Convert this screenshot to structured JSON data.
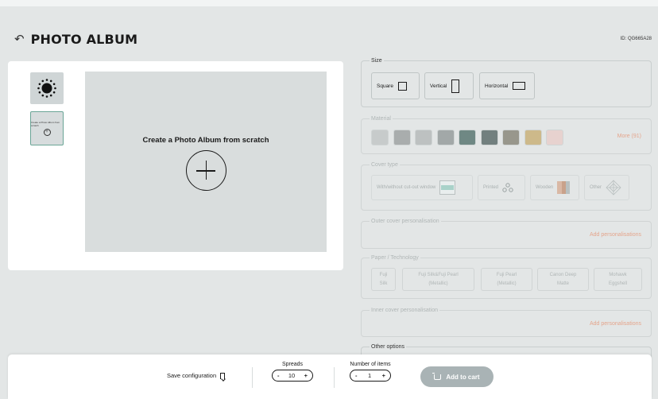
{
  "header": {
    "title": "PHOTO ALBUM",
    "back_icon": "back-arrow-icon",
    "product_id": "ID: QG665A28"
  },
  "preview": {
    "canvas_title": "Create a Photo Album from scratch",
    "thumb_mini_text": "Create a Photo Album from scratch"
  },
  "size": {
    "legend": "Size",
    "options": [
      {
        "label": "Square",
        "icon": "square-shape-icon"
      },
      {
        "label": "Vertical",
        "icon": "vertical-shape-icon"
      },
      {
        "label": "Horizontal",
        "icon": "horizontal-shape-icon"
      }
    ]
  },
  "material": {
    "legend": "Material",
    "swatches": [
      "#c7cbcb",
      "#a9adad",
      "#bdc1c1",
      "#a2a8a8",
      "#6f8884",
      "#72807f",
      "#98978c",
      "#cdb98a",
      "#e7d2cf"
    ],
    "more": "More (91)"
  },
  "cover_type": {
    "legend": "Cover type",
    "options": [
      {
        "label": "With/without cut-out window"
      },
      {
        "label": "Printed"
      },
      {
        "label": "Wooden"
      },
      {
        "label": "Other"
      }
    ]
  },
  "outer_cover": {
    "legend": "Outer cover personalisation",
    "link": "Add personalisations"
  },
  "paper": {
    "legend": "Paper / Technology",
    "options": [
      {
        "line1": "Fuji",
        "line2": "Silk"
      },
      {
        "line1": "Fuji Silk&Fuji Pearl",
        "line2": "(Metallic)"
      },
      {
        "line1": "Fuji Pearl",
        "line2": "(Metallic)"
      },
      {
        "line1": "Canon Deep",
        "line2": "Matte"
      },
      {
        "line1": "Mohawk",
        "line2": "Eggshell"
      }
    ]
  },
  "inner_cover": {
    "legend": "Inner cover personalisation",
    "link": "Add personalisations"
  },
  "other_options": {
    "legend": "Other options"
  },
  "footer": {
    "save_label": "Save configuration",
    "spreads_label": "Spreads",
    "spreads_value": "10",
    "items_label": "Number of items",
    "items_value": "1",
    "minus": "-",
    "plus": "+",
    "cart_label": "Add to cart"
  }
}
